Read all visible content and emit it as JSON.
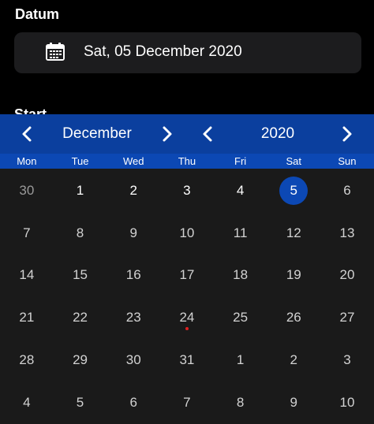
{
  "date_label": "Datum",
  "date_field": {
    "value": "Sat, 05 December 2020",
    "icon": "calendar-icon"
  },
  "start_label": "Start",
  "picker": {
    "month": "December",
    "year": "2020",
    "weekdays": [
      "Mon",
      "Tue",
      "Wed",
      "Thu",
      "Fri",
      "Sat",
      "Sun"
    ],
    "weeks": [
      [
        "30",
        "1",
        "2",
        "3",
        "4",
        "5",
        "6"
      ],
      [
        "7",
        "8",
        "9",
        "10",
        "11",
        "12",
        "13"
      ],
      [
        "14",
        "15",
        "16",
        "17",
        "18",
        "19",
        "20"
      ],
      [
        "21",
        "22",
        "23",
        "24",
        "25",
        "26",
        "27"
      ],
      [
        "28",
        "29",
        "30",
        "31",
        "1",
        "2",
        "3"
      ],
      [
        "4",
        "5",
        "6",
        "7",
        "8",
        "9",
        "10"
      ]
    ],
    "selected_day": "5",
    "today_marker_day": "24",
    "colors": {
      "header": "#0b3f9e",
      "weekday_bar": "#0c48b4",
      "selected": "#0c48b4",
      "today_dot": "#e02020"
    }
  }
}
